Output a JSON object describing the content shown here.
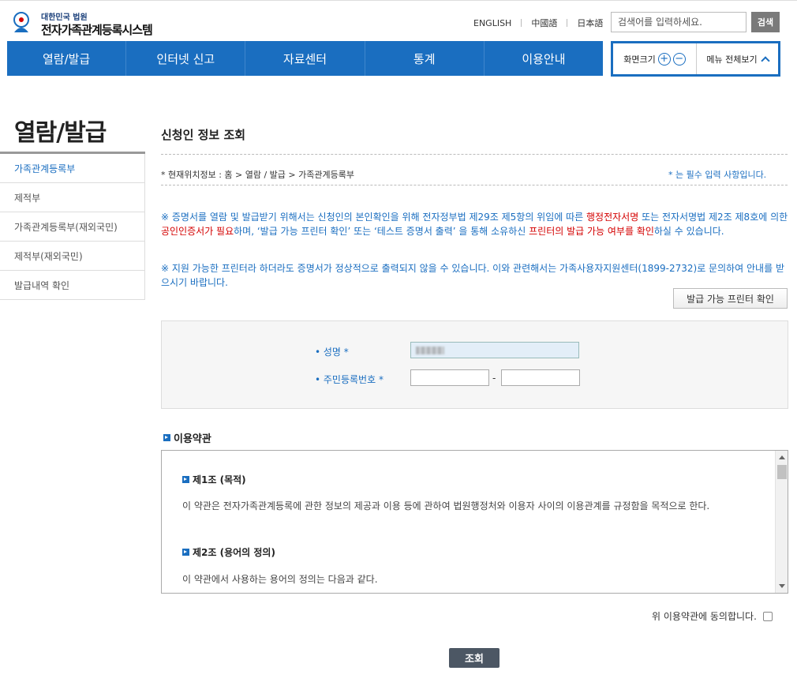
{
  "header": {
    "logo_sub": "대한민국 법원",
    "logo_title": "전자가족관계등록시스템",
    "languages": [
      "ENGLISH",
      "中國語",
      "日本語"
    ],
    "search_placeholder": "검색어를 입력하세요.",
    "search_button": "검색"
  },
  "nav": {
    "items": [
      "열람/발급",
      "인터넷 신고",
      "자료센터",
      "통계",
      "이용안내"
    ],
    "zoom_label": "화면크기",
    "zoom_in": "+",
    "zoom_out": "−",
    "all_menu": "메뉴 전체보기"
  },
  "sidebar": {
    "title": "열람/발급",
    "items": [
      {
        "label": "가족관계등록부"
      },
      {
        "label": "제적부"
      },
      {
        "label": "가족관계등록부(재외국민)"
      },
      {
        "label": "제적부(재외국민)"
      },
      {
        "label": "발급내역 확인"
      }
    ]
  },
  "content": {
    "title": "신청인 정보 조회",
    "location": "* 현재위치정보 : 홈 > 열람 / 발급 > 가족관계등록부",
    "required_note": "* 는 필수 입력 사항입니다.",
    "notice1": {
      "p1": "※ 증명서를 열람 및 발급받기 위해서는 신청인의 본인확인을 위해 전자정부법 제29조 제5항의 위임에 따른 ",
      "r1": "행정전자서명",
      "p2": " 또는 전자서명법 제2조 제8호에 의한 ",
      "r2": "공인인증서가 필요",
      "p3": "하며, ‘발급 가능 프린터 확인’ 또는 ‘테스트 증명서 출력’ 을 통해 소유하신 ",
      "r3": "프린터의 발급 가능 여부를 확인",
      "p4": "하실 수 있습니다."
    },
    "notice2": "※ 지원 가능한 프린터라 하더라도 증명서가 정상적으로 출력되지 않을 수 있습니다. 이와 관련해서는 가족사용자지원센터(1899-2732)로 문의하여 안내를 받으시기 바랍니다.",
    "printer_button": "발급 가능 프린터 확인",
    "form": {
      "name_label": "• 성명 *",
      "rrn_label": "• 주민등록번호 *",
      "rrn_dash": "-"
    },
    "terms": {
      "heading": "이용약관",
      "article1_title": "제1조 (목적)",
      "article1_text": "이 약관은 전자가족관계등록에 관한 정보의 제공과 이용 등에 관하여 법원행정처와 이용자 사이의 이용관계를 규정함을 목적으로 한다.",
      "article2_title": "제2조 (용어의 정의)",
      "article2_text": "이 약관에서 사용하는 용어의 정의는 다음과 같다."
    },
    "agree_label": "위 이용약관에 동의합니다.",
    "submit_button": "조회"
  },
  "colors": {
    "primary": "#1a6ec0",
    "highlight": "#d40000",
    "submit": "#4c5764"
  }
}
